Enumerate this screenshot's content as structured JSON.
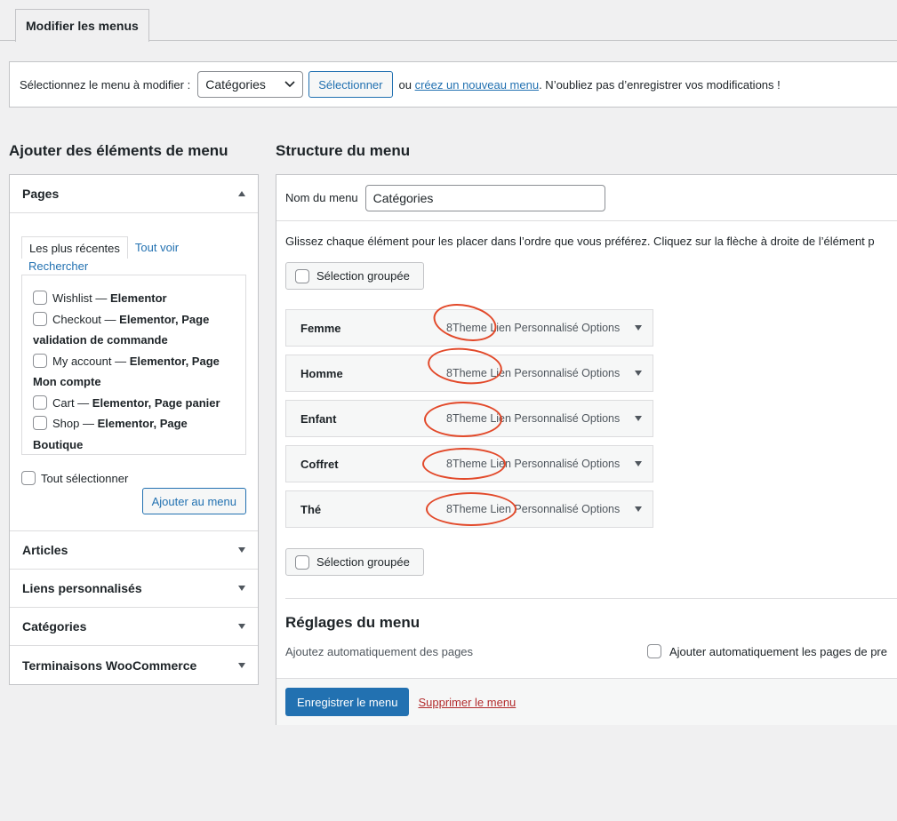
{
  "tab": {
    "label": "Modifier les menus"
  },
  "select_bar": {
    "label": "Sélectionnez le menu à modifier :",
    "selected": "Catégories",
    "select_button": "Sélectionner",
    "or": "ou",
    "create_link": "créez un nouveau menu",
    "tail": ". N’oubliez pas d’enregistrer vos modifications !"
  },
  "left": {
    "heading": "Ajouter des éléments de menu",
    "pages": {
      "title": "Pages",
      "tabs": [
        "Les plus récentes",
        "Tout voir",
        "Rechercher"
      ],
      "items": [
        {
          "name": "Wishlist",
          "sep": " — ",
          "tags": "Elementor"
        },
        {
          "name": "Checkout",
          "sep": " — ",
          "tags": "Elementor, Page validation de commande"
        },
        {
          "name": "My account",
          "sep": " — ",
          "tags": "Elementor, Page Mon compte"
        },
        {
          "name": "Cart",
          "sep": " — ",
          "tags": "Elementor, Page panier"
        },
        {
          "name": "Shop",
          "sep": " — ",
          "tags": "Elementor, Page Boutique"
        }
      ],
      "select_all": "Tout sélectionner",
      "add_button": "Ajouter au menu"
    },
    "sections": [
      "Articles",
      "Liens personnalisés",
      "Catégories",
      "Terminaisons WooCommerce"
    ]
  },
  "right": {
    "heading": "Structure du menu",
    "name_label": "Nom du menu",
    "name_value": "Catégories",
    "instructions": "Glissez chaque élément pour les placer dans l’ordre que vous préférez. Cliquez sur la flèche à droite de l’élément p",
    "bulk_select": "Sélection groupée",
    "items": [
      {
        "title": "Femme",
        "meta": "8Theme Lien Personnalisé Options"
      },
      {
        "title": "Homme",
        "meta": "8Theme Lien Personnalisé Options"
      },
      {
        "title": "Enfant",
        "meta": "8Theme Lien Personnalisé Options"
      },
      {
        "title": "Coffret",
        "meta": "8Theme Lien Personnalisé Options"
      },
      {
        "title": "Thé",
        "meta": "8Theme Lien Personnalisé Options"
      }
    ],
    "settings_title": "Réglages du menu",
    "auto_add_label": "Ajoutez automatiquement des pages",
    "auto_add_check": "Ajouter automatiquement les pages de pre",
    "save_button": "Enregistrer le menu",
    "delete_link": "Supprimer le menu"
  },
  "annotation_color": "#e2492a"
}
